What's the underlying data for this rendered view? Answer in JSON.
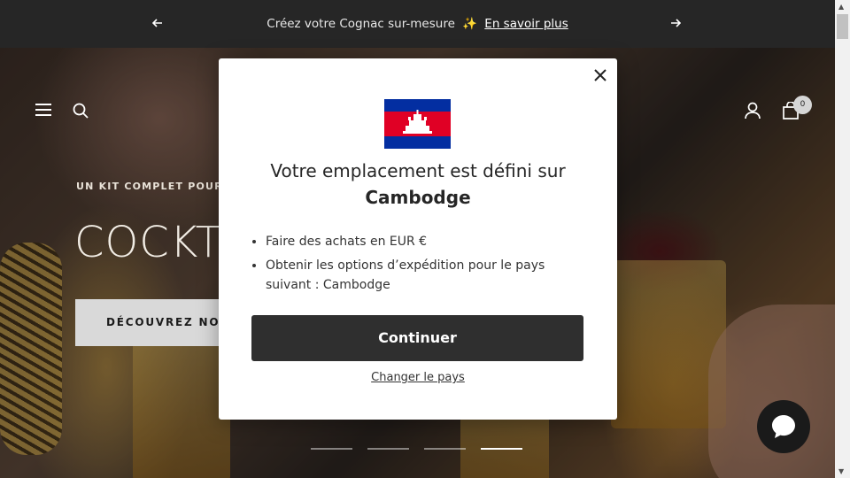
{
  "announcement": {
    "message": "Créez votre Cognac sur-mesure",
    "sparkle": "✨",
    "link": "En savoir plus",
    "prev_icon": "arrow-left-icon",
    "next_icon": "arrow-right-icon"
  },
  "header": {
    "icons": [
      "menu-icon",
      "search-icon",
      "account-icon",
      "cart-icon"
    ],
    "cart_count": "0"
  },
  "hero": {
    "eyebrow": "UN KIT COMPLET POUR CR",
    "title": "COCKTA",
    "cta": "DÉCOUVREZ NOS"
  },
  "slider": {
    "slides": 4,
    "active": 4
  },
  "modal": {
    "line1": "Votre emplacement est défini sur",
    "country": "Cambodge",
    "bullets": [
      "Faire des achats en EUR €",
      "Obtenir les options d’expédition pour le pays suivant : Cambodge"
    ],
    "continue": "Continuer",
    "change": "Changer le pays",
    "flag": "cambodia-flag-icon"
  },
  "colors": {
    "announcement_bg": "#262626",
    "button_dark": "#2f2f2f",
    "flag_blue": "#032ea1",
    "flag_red": "#e00025"
  }
}
